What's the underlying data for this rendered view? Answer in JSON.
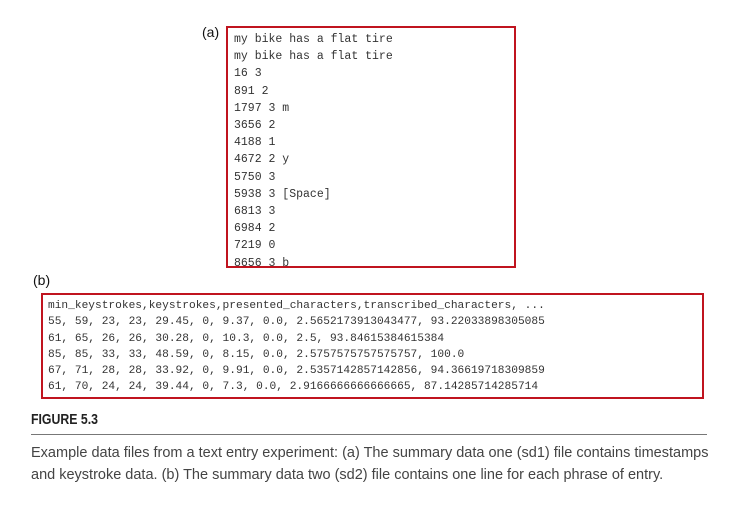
{
  "panel_a": {
    "label": "(a)",
    "lines": [
      "my bike has a flat tire",
      "my bike has a flat tire",
      "16 3",
      "891 2",
      "1797 3 m",
      "3656 2",
      "4188 1",
      "4672 2 y",
      "5750 3",
      "5938 3 [Space]",
      "6813 3",
      "6984 2",
      "7219 0",
      "8656 3 b"
    ]
  },
  "panel_b": {
    "label": "(b)",
    "lines": [
      "min_keystrokes,keystrokes,presented_characters,transcribed_characters, ...",
      "55, 59, 23, 23, 29.45, 0, 9.37, 0.0, 2.5652173913043477, 93.22033898305085",
      "61, 65, 26, 26, 30.28, 0, 10.3, 0.0, 2.5, 93.84615384615384",
      "85, 85, 33, 33, 48.59, 0, 8.15, 0.0, 2.5757575757575757, 100.0",
      "67, 71, 28, 28, 33.92, 0, 9.91, 0.0, 2.5357142857142856, 94.36619718309859",
      "61, 70, 24, 24, 39.44, 0, 7.3, 0.0, 2.9166666666666665, 87.14285714285714"
    ]
  },
  "figure": {
    "title": "FIGURE 5.3",
    "caption": "Example data files from a text entry experiment: (a) The summary data one (sd1) file contains timestamps and keystroke data. (b) The summary data two (sd2) file contains one line for each phrase of entry."
  },
  "colors": {
    "box_border": "#c0141f",
    "caption_text": "#444444"
  }
}
